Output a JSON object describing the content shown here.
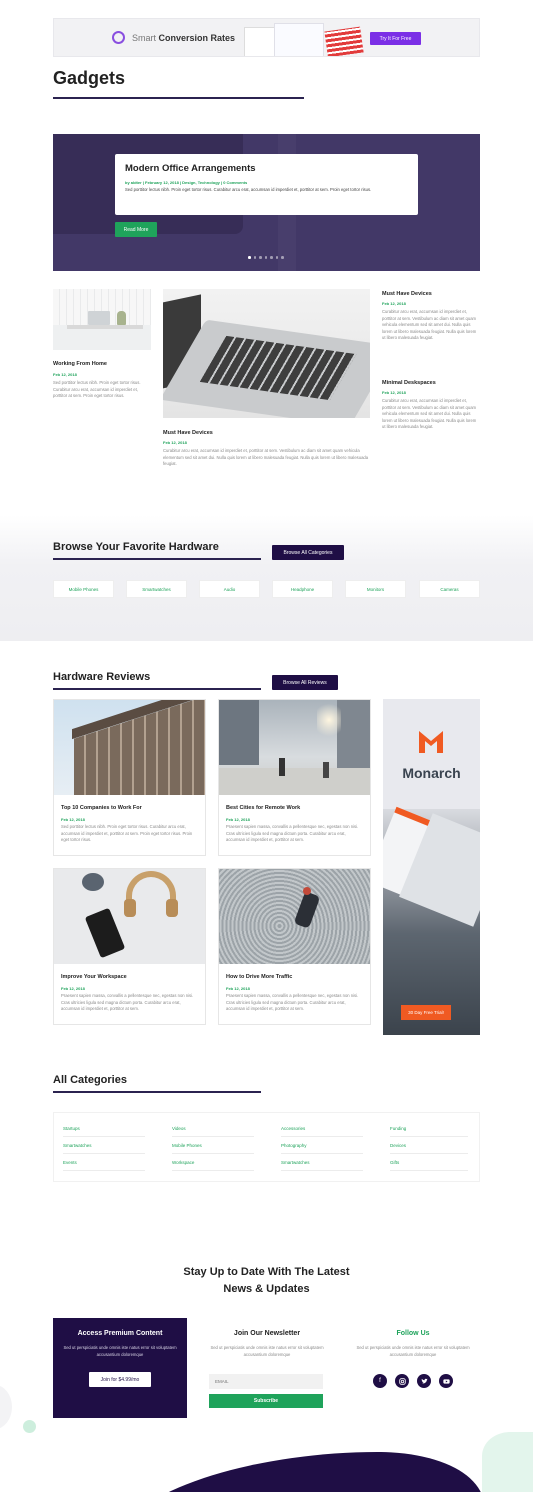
{
  "ad_banner": {
    "brand_light": "Smart",
    "brand_bold": "Conversion Rates",
    "cta": "Try It For Free"
  },
  "page_title": "Gadgets",
  "hero": {
    "title": "Modern Office Arrangements",
    "meta": "by aldter | February 12, 2018 | Design, Technology | 0 Comments",
    "excerpt": "Sed porttitor lectus nibh. Proin eget tortor risus. Curabitur arcu erat, accumsan id imperdiet et, porttitor at sem. Proin eget tortor risus.",
    "button": "Read More",
    "dots": 7
  },
  "posts": {
    "left": {
      "title": "Working From Home",
      "date": "Feb 12, 2018",
      "excerpt": "Sed porttitor lectus nibh. Proin eget tortor risus. Curabitur arcu erat, accumsan id imperdiet et, porttitor at sem. Proin eget tortor risus."
    },
    "center": {
      "title": "Must Have Devices",
      "date": "Feb 12, 2018",
      "excerpt": "Curabitur arcu erat, accumsan id imperdiet et, porttitor at sem. Vestibulum ac diam sit amet quam vehicula elementum sed sit amet dui. Nulla quis lorem ut libero malesuada feugiat. Nulla quis lorem ut libero malesuada feugiat."
    },
    "right_1": {
      "title": "Must Have Devices",
      "date": "Feb 12, 2018",
      "excerpt": "Curabitur arcu erat, accumsan id imperdiet et, porttitor at sem. Vestibulum ac diam sit amet quam vehicula elementum sed sit amet dui. Nulla quis lorem ut libero malesuada feugiat. Nulla quis lorem ut libero malesuada feugiat."
    },
    "right_2": {
      "title": "Minimal Deskspaces",
      "date": "Feb 12, 2018",
      "excerpt": "Curabitur arcu erat, accumsan id imperdiet et, porttitor at sem. Vestibulum ac diam sit amet quam vehicula elementum sed sit amet dui. Nulla quis lorem ut libero malesuada feugiat. Nulla quis lorem ut libero malesuada feugiat."
    }
  },
  "browse": {
    "title": "Browse Your Favorite Hardware",
    "button": "Browse All Categories",
    "categories": [
      "Mobile Phones",
      "Smartwatches",
      "Audio",
      "Headphone",
      "Monitors",
      "Cameras"
    ]
  },
  "reviews": {
    "title": "Hardware Reviews",
    "button": "Browse All Reviews",
    "cards": [
      {
        "title": "Top 10 Companies to Work For",
        "date": "Feb 12, 2018",
        "excerpt": "Sed porttitor lectus nibh. Proin eget tortor risus. Curabitur arcu erat, accumsan id imperdiet et, porttitor at sem. Proin eget tortor risus. Proin eget tortor risus."
      },
      {
        "title": "Best Cities for Remote Work",
        "date": "Feb 12, 2018",
        "excerpt": "Praesent sapien massa, convallis a pellentesque nec, egestas non nisi. Cras ultricies ligula sed magna dictum porta. Curabitur arcu erat, accumsan id imperdiet et, porttitor at sem."
      },
      {
        "title": "Improve Your Workspace",
        "date": "Feb 12, 2018",
        "excerpt": "Praesent sapien massa, convallis a pellentesque nec, egestas non nisi. Cras ultricies ligula sed magna dictum porta. Curabitur arcu erat, accumsan id imperdiet et, porttitor at sem."
      },
      {
        "title": "How to Drive More Traffic",
        "date": "Feb 12, 2018",
        "excerpt": "Praesent sapien massa, convallis a pellentesque nec, egestas non nisi. Cras ultricies ligula sed magna dictum porta. Curabitur arcu erat, accumsan id imperdiet et, porttitor at sem."
      }
    ],
    "ad": {
      "brand": "Monarch",
      "cta": "30 Day Free Trial!"
    }
  },
  "all_categories": {
    "title": "All Categories",
    "columns": [
      [
        "Startups",
        "Smartwatches",
        "Events"
      ],
      [
        "Videos",
        "Mobile Phones",
        "Workspace"
      ],
      [
        "Accessories",
        "Photography",
        "Smartwatches"
      ],
      [
        "Funding",
        "Devices",
        "Gifts"
      ]
    ]
  },
  "newsletter": {
    "heading_line1": "Stay Up to Date With The Latest",
    "heading_line2": "News & Updates",
    "premium": {
      "title": "Access Premium Content",
      "text": "Sed ut perspiciatis unde omnis iste natus error sit voluptatem accusantium doloremque",
      "button": "Join for $4.99/mo"
    },
    "join": {
      "title": "Join Our Newsletter",
      "text": "Sed ut perspiciatis unde omnis iste natus error sit voluptatem accusantium doloremque",
      "email_placeholder": "EMAIL",
      "button": "Subscribe"
    },
    "follow": {
      "title": "Follow Us",
      "text": "Sed ut perspiciatis unde omnis iste natus error sit voluptatem accusantium doloremque",
      "icons": [
        "facebook-icon",
        "instagram-icon",
        "twitter-icon",
        "youtube-icon"
      ]
    }
  },
  "colors": {
    "accent_green": "#1fa35b",
    "dark_purple": "#1f0e45",
    "hero_overlay": "#3f3760",
    "monarch_orange": "#f05a22",
    "ad_purple": "#7b2fe6"
  }
}
